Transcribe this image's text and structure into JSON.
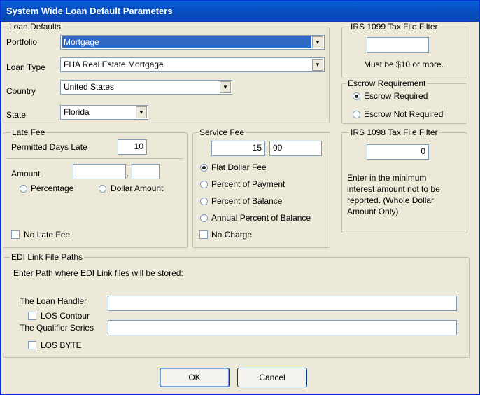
{
  "window": {
    "title": "System Wide Loan Default Parameters"
  },
  "loan_defaults": {
    "group_label": "Loan Defaults",
    "portfolio_label": "Portfolio",
    "portfolio_value": "Mortgage",
    "loan_type_label": "Loan Type",
    "loan_type_value": "FHA Real Estate Mortgage",
    "country_label": "Country",
    "country_value": "United States",
    "state_label": "State",
    "state_value": "Florida"
  },
  "irs1099": {
    "group_label": "IRS 1099 Tax File Filter",
    "value": "",
    "note": "Must be $10 or more."
  },
  "escrow": {
    "group_label": "Escrow Requirement",
    "required_label": "Escrow Required",
    "not_required_label": "Escrow Not Required",
    "selected": "required"
  },
  "late_fee": {
    "group_label": "Late Fee",
    "permitted_days_label": "Permitted Days Late",
    "permitted_days_value": "10",
    "amount_label": "Amount",
    "amount_whole": "",
    "amount_separator": ".",
    "amount_fraction": "",
    "percentage_label": "Percentage",
    "dollar_amount_label": "Dollar Amount",
    "no_late_fee_label": "No Late Fee"
  },
  "service_fee": {
    "group_label": "Service Fee",
    "amount_whole": "15",
    "amount_separator": ".",
    "amount_fraction": "00",
    "options": {
      "flat": "Flat Dollar Fee",
      "percent_payment": "Percent of Payment",
      "percent_balance": "Percent of Balance",
      "annual_percent_balance": "Annual Percent of Balance"
    },
    "selected": "flat",
    "no_charge_label": "No Charge"
  },
  "irs1098": {
    "group_label": "IRS 1098 Tax File Filter",
    "value": "0",
    "note_line1": "Enter in the minimum",
    "note_line2": "interest amount not to be",
    "note_line3": "reported. (Whole Dollar",
    "note_line4": "Amount Only)"
  },
  "edi": {
    "group_label": "EDI Link File Paths",
    "instruction": "Enter Path where EDI Link files will be stored:",
    "loan_handler_label": "The Loan Handler",
    "loan_handler_value": "",
    "los_contour_label": "LOS Contour",
    "qualifier_label": "The Qualifier Series",
    "qualifier_value": "",
    "los_byte_label": "LOS BYTE"
  },
  "buttons": {
    "ok": "OK",
    "cancel": "Cancel"
  }
}
